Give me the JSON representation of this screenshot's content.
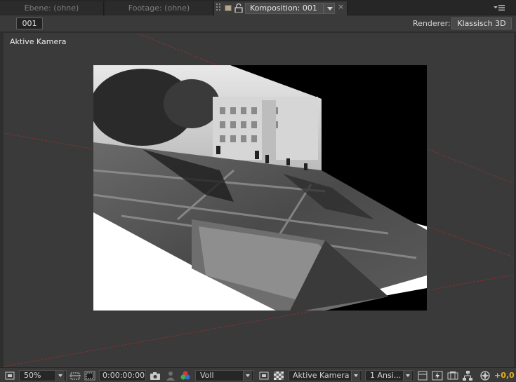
{
  "tabs": {
    "layer": "Ebene: (ohne)",
    "footage": "Footage: (ohne)",
    "composition": "Komposition: 001",
    "close_symbol": "×"
  },
  "toolbar": {
    "comp_button": "001",
    "renderer_label": "Renderer:",
    "renderer_value": "Klassisch 3D"
  },
  "viewer": {
    "view_label": "Aktive Kamera",
    "background_color": "#3a3a3a",
    "camera_line_color": "#8a3030"
  },
  "bottom": {
    "magnification": "50%",
    "timecode": "0:00:00:00",
    "resolution": "Voll",
    "camera": "Aktive Kamera",
    "views": "1 Ansi...",
    "exposure": "+0,0"
  },
  "icons": [
    "always-preview-icon",
    "region-of-interest-icon",
    "transparency-grid-icon",
    "snapshot-icon",
    "show-snapshot-icon",
    "channel-rgb-icon",
    "toggle-mask-icon",
    "checkerboard-icon",
    "view-layout-icon",
    "fast-preview-icon",
    "timeline-icon",
    "flowchart-icon",
    "reset-exposure-icon",
    "panel-menu-icon",
    "lock-icon"
  ]
}
